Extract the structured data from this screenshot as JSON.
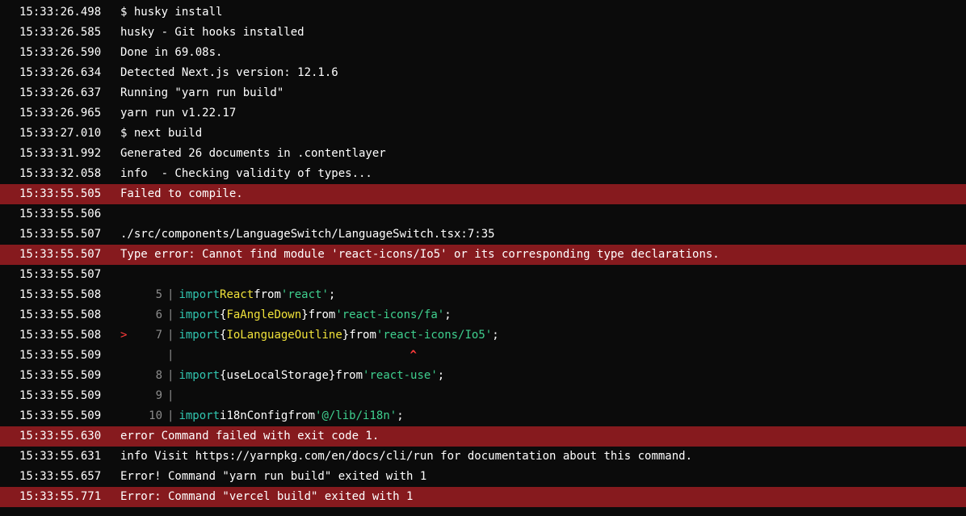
{
  "colors": {
    "background": "#0b0b0b",
    "error_row": "#861a1e",
    "keyword": "#31c6b0",
    "string": "#3fd08f",
    "identifier": "#f0e23a",
    "gutter": "#8c8c8c",
    "marker": "#ff3b3b"
  },
  "lines": [
    {
      "ts": "15:33:26.498",
      "msg": "$ husky install"
    },
    {
      "ts": "15:33:26.585",
      "msg": "husky - Git hooks installed"
    },
    {
      "ts": "15:33:26.590",
      "msg": "Done in 69.08s."
    },
    {
      "ts": "15:33:26.634",
      "msg": "Detected Next.js version: 12.1.6"
    },
    {
      "ts": "15:33:26.637",
      "msg": "Running \"yarn run build\""
    },
    {
      "ts": "15:33:26.965",
      "msg": "yarn run v1.22.17"
    },
    {
      "ts": "15:33:27.010",
      "msg": "$ next build"
    },
    {
      "ts": "15:33:31.992",
      "msg": "Generated 26 documents in .contentlayer"
    },
    {
      "ts": "15:33:32.058",
      "msg": "info  - Checking validity of types..."
    },
    {
      "ts": "15:33:55.505",
      "msg": "Failed to compile."
    },
    {
      "ts": "15:33:55.506",
      "msg": ""
    },
    {
      "ts": "15:33:55.507",
      "msg": "./src/components/LanguageSwitch/LanguageSwitch.tsx:7:35"
    },
    {
      "ts": "15:33:55.507",
      "msg": "Type error: Cannot find module 'react-icons/Io5' or its corresponding type declarations."
    },
    {
      "ts": "15:33:55.507",
      "msg": ""
    },
    {
      "ts": "15:33:55.508"
    },
    {
      "ts": "15:33:55.508"
    },
    {
      "ts": "15:33:55.508"
    },
    {
      "ts": "15:33:55.509"
    },
    {
      "ts": "15:33:55.509"
    },
    {
      "ts": "15:33:55.509"
    },
    {
      "ts": "15:33:55.509"
    },
    {
      "ts": "15:33:55.630",
      "msg": "error Command failed with exit code 1."
    },
    {
      "ts": "15:33:55.631",
      "msg": "info Visit https://yarnpkg.com/en/docs/cli/run for documentation about this command."
    },
    {
      "ts": "15:33:55.657",
      "msg": "Error! Command \"yarn run build\" exited with 1"
    },
    {
      "ts": "15:33:55.771",
      "msg": "Error: Command \"vercel build\" exited with 1"
    }
  ],
  "code": {
    "l5": {
      "num": "5",
      "kw1": "import",
      "ident": "React",
      "kw2": "from",
      "str": "'react'",
      "end": ";"
    },
    "l6": {
      "num": "6",
      "kw1": "import",
      "open": "{",
      "ident": "FaAngleDown",
      "close": "}",
      "kw2": "from",
      "str": "'react-icons/fa'",
      "end": ";"
    },
    "l7": {
      "marker": ">",
      "num": "7",
      "kw1": "import",
      "open": "{",
      "ident": "IoLanguageOutline",
      "close": "}",
      "kw2": "from",
      "str": "'react-icons/Io5'",
      "end": ";"
    },
    "caret": "^",
    "l8": {
      "num": "8",
      "kw1": "import",
      "open": "{",
      "ident": "useLocalStorage",
      "close": "}",
      "kw2": "from",
      "str": "'react-use'",
      "end": ";"
    },
    "l9": {
      "num": "9"
    },
    "l10": {
      "num": "10",
      "kw1": "import",
      "ident": "i18nConfig",
      "kw2": "from",
      "str": "'@/lib/i18n'",
      "end": ";"
    },
    "bar": "|"
  }
}
